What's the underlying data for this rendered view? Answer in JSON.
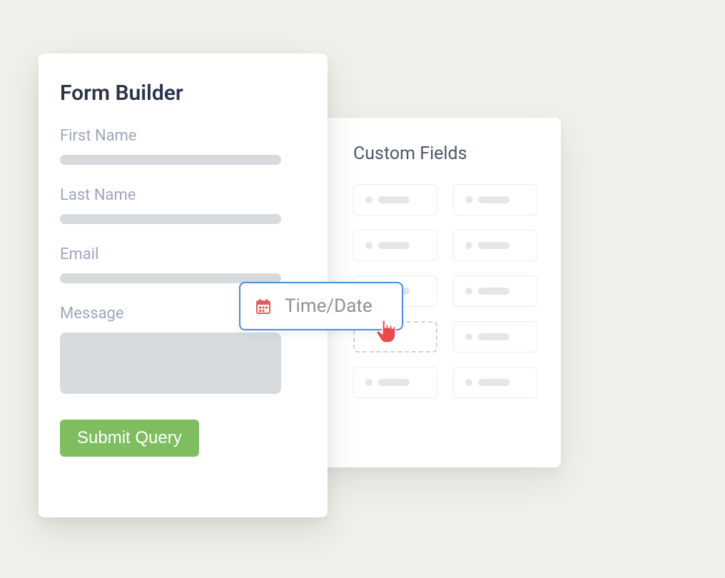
{
  "formBuilder": {
    "title": "Form Builder",
    "fields": [
      {
        "label": "First Name"
      },
      {
        "label": "Last Name"
      },
      {
        "label": "Email"
      },
      {
        "label": "Message"
      }
    ],
    "submitLabel": "Submit Query"
  },
  "customFields": {
    "title": "Custom Fields"
  },
  "dragChip": {
    "label": "Time/Date"
  }
}
